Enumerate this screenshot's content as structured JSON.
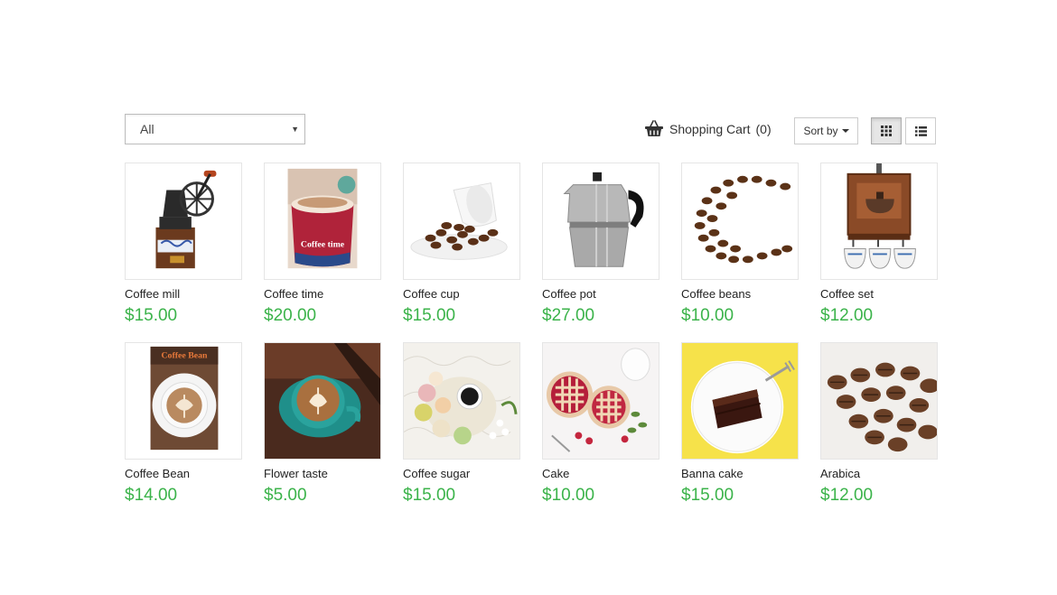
{
  "filter": {
    "selected": "All"
  },
  "cart": {
    "label": "Shopping Cart",
    "count": "(0)",
    "icon": "basket-icon"
  },
  "sort": {
    "label": "Sort by"
  },
  "view": {
    "grid_icon": "grid-icon",
    "list_icon": "list-icon"
  },
  "accent_color": "#3bb34a",
  "products": [
    {
      "name": "Coffee mill",
      "price": "$15.00",
      "image_caption": ""
    },
    {
      "name": "Coffee time",
      "price": "$20.00",
      "image_caption": "Coffee time"
    },
    {
      "name": "Coffee cup",
      "price": "$15.00",
      "image_caption": ""
    },
    {
      "name": "Coffee pot",
      "price": "$27.00",
      "image_caption": ""
    },
    {
      "name": "Coffee beans",
      "price": "$10.00",
      "image_caption": ""
    },
    {
      "name": "Coffee set",
      "price": "$12.00",
      "image_caption": ""
    },
    {
      "name": "Coffee Bean",
      "price": "$14.00",
      "image_caption": "Coffee Bean"
    },
    {
      "name": "Flower taste",
      "price": "$5.00",
      "image_caption": ""
    },
    {
      "name": "Coffee sugar",
      "price": "$15.00",
      "image_caption": ""
    },
    {
      "name": "Cake",
      "price": "$10.00",
      "image_caption": ""
    },
    {
      "name": "Banna cake",
      "price": "$15.00",
      "image_caption": ""
    },
    {
      "name": "Arabica",
      "price": "$12.00",
      "image_caption": ""
    }
  ]
}
